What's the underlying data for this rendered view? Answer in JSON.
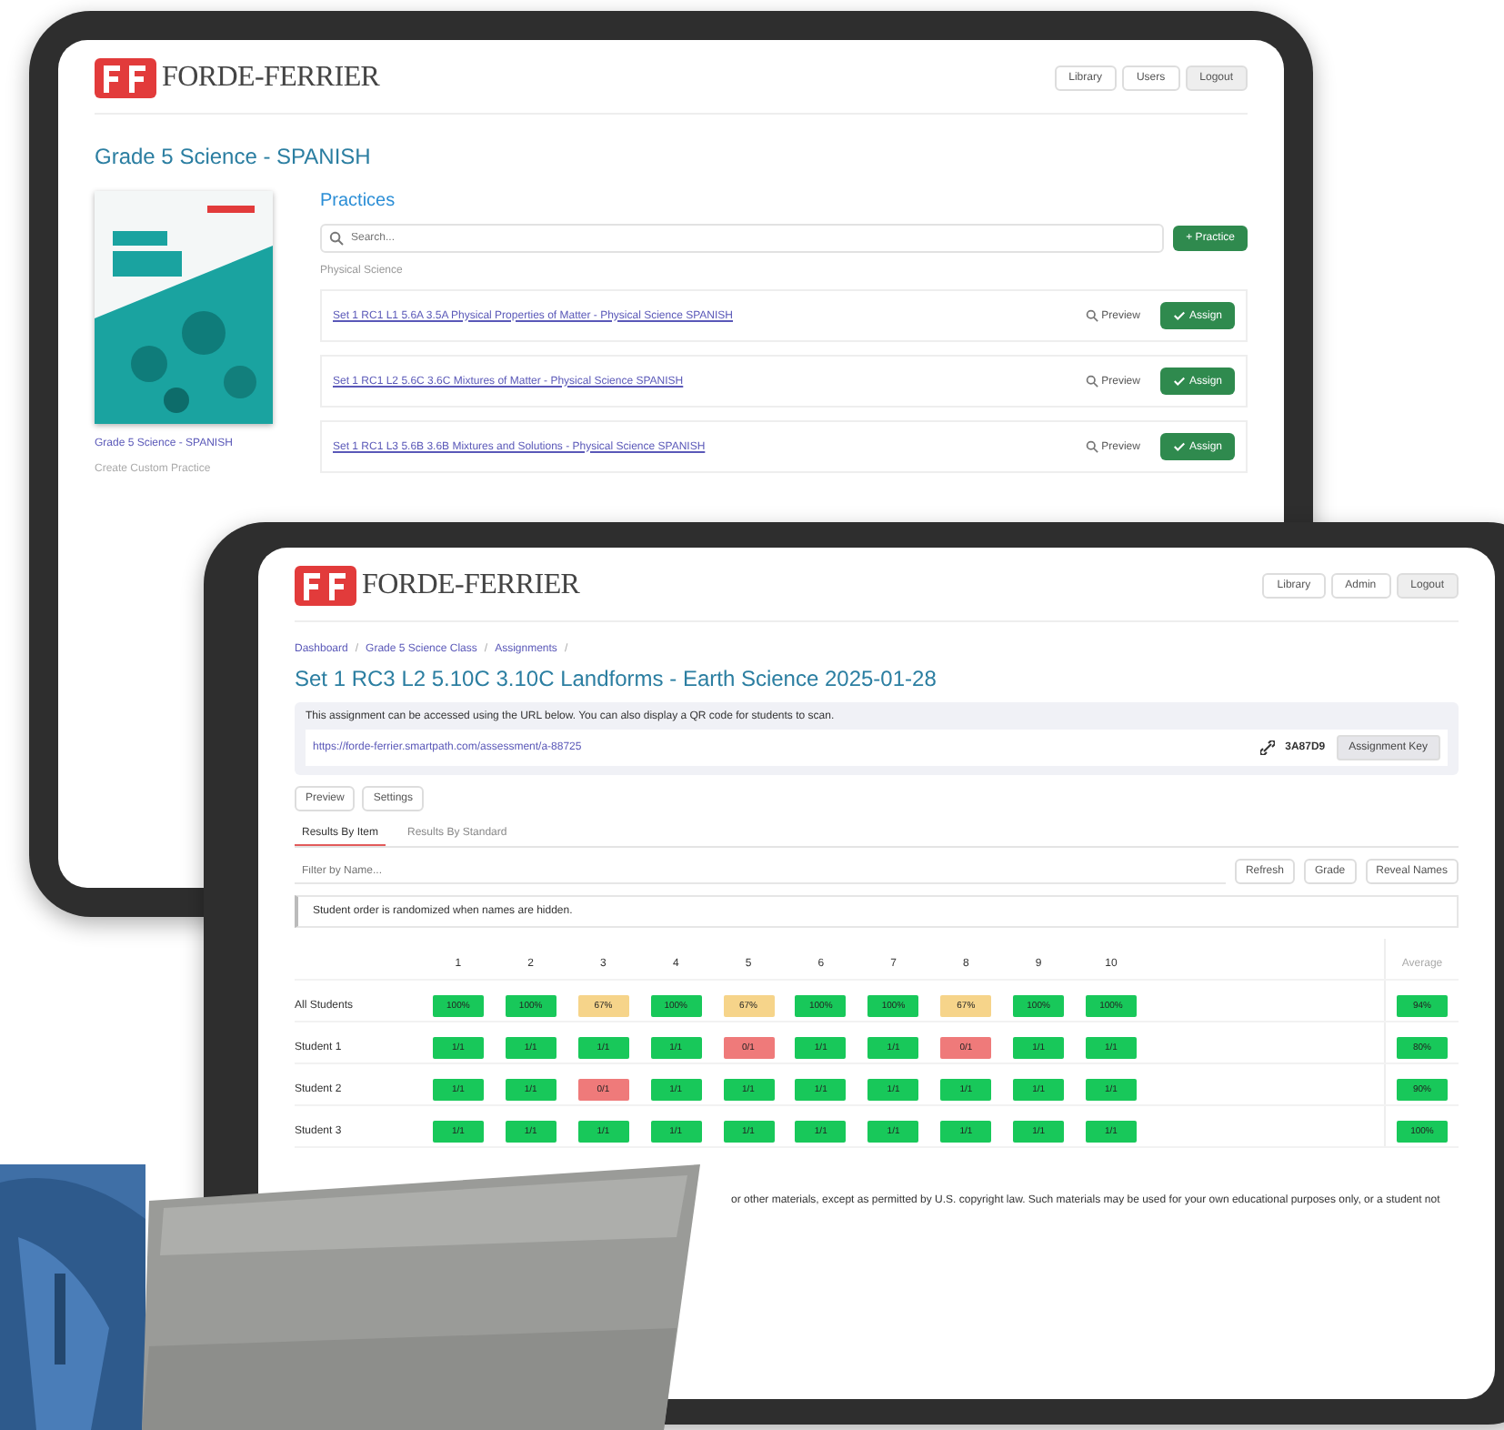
{
  "back_screen": {
    "logo": "FORDE-FERRIER",
    "header_buttons": [
      "Library",
      "Users",
      "Logout"
    ],
    "title": "Grade 5 Science - SPANISH",
    "cover_link": "Grade 5 Science - SPANISH",
    "sidebar_link": "Create Custom Practice",
    "section_title": "Practices",
    "search": {
      "placeholder": "Search..."
    },
    "add_button": "+ Practice",
    "group_label": "Physical Science",
    "practices": [
      {
        "title": "Set 1 RC1 L1 5.6A 3.5A Physical Properties of Matter - Physical Science SPANISH",
        "preview": "Preview",
        "assign": "Assign"
      },
      {
        "title": "Set 1 RC1 L2 5.6C 3.6C Mixtures of Matter - Physical Science SPANISH",
        "preview": "Preview",
        "assign": "Assign"
      },
      {
        "title": "Set 1 RC1 L3 5.6B 3.6B Mixtures and Solutions - Physical Science SPANISH",
        "preview": "Preview",
        "assign": "Assign"
      }
    ]
  },
  "front_screen": {
    "logo": "FORDE-FERRIER",
    "header_buttons": [
      "Library",
      "Admin",
      "Logout"
    ],
    "breadcrumb": [
      "Dashboard",
      "/",
      "Grade 5 Science Class",
      "/",
      "Assignments",
      "/"
    ],
    "title": "Set 1 RC3 L2 5.10C 3.10C Landforms - Earth Science 2025-01-28",
    "info": {
      "text": "This assignment can be accessed using the URL below. You can also display a QR code for students to scan.",
      "url": "https://forde-ferrier.smartpath.com/assessment/a-88725",
      "code": "3A87D9",
      "key_button": "Assignment Key"
    },
    "actions": [
      "Preview",
      "Settings"
    ],
    "tabs": [
      {
        "label": "Results By Item",
        "selected": true
      },
      {
        "label": "Results By Standard",
        "selected": false
      }
    ],
    "filter": {
      "placeholder": "Filter by Name..."
    },
    "tools": [
      "Refresh",
      "Grade",
      "Reveal Names"
    ],
    "notice": "Student order is randomized when names are hidden.",
    "grid": {
      "columns": [
        "1",
        "2",
        "3",
        "4",
        "5",
        "6",
        "7",
        "8",
        "9",
        "10"
      ],
      "average_label": "Average",
      "rows": [
        {
          "name": "All Students",
          "average": "94%",
          "cells": [
            {
              "text": "100%",
              "color": "#18c85a"
            },
            {
              "text": "100%",
              "color": "#18c85a"
            },
            {
              "text": "67%",
              "color": "#f6d48a"
            },
            {
              "text": "100%",
              "color": "#18c85a"
            },
            {
              "text": "67%",
              "color": "#f6d48a"
            },
            {
              "text": "100%",
              "color": "#18c85a"
            },
            {
              "text": "100%",
              "color": "#18c85a"
            },
            {
              "text": "67%",
              "color": "#f6d48a"
            },
            {
              "text": "100%",
              "color": "#18c85a"
            },
            {
              "text": "100%",
              "color": "#18c85a"
            }
          ]
        },
        {
          "name": "Student 1",
          "average": "80%",
          "cells": [
            {
              "text": "1/1",
              "color": "#18c85a"
            },
            {
              "text": "1/1",
              "color": "#18c85a"
            },
            {
              "text": "1/1",
              "color": "#18c85a"
            },
            {
              "text": "1/1",
              "color": "#18c85a"
            },
            {
              "text": "0/1",
              "color": "#ef7a7a"
            },
            {
              "text": "1/1",
              "color": "#18c85a"
            },
            {
              "text": "1/1",
              "color": "#18c85a"
            },
            {
              "text": "0/1",
              "color": "#ef7a7a"
            },
            {
              "text": "1/1",
              "color": "#18c85a"
            },
            {
              "text": "1/1",
              "color": "#18c85a"
            }
          ]
        },
        {
          "name": "Student 2",
          "average": "90%",
          "cells": [
            {
              "text": "1/1",
              "color": "#18c85a"
            },
            {
              "text": "1/1",
              "color": "#18c85a"
            },
            {
              "text": "0/1",
              "color": "#ef7a7a"
            },
            {
              "text": "1/1",
              "color": "#18c85a"
            },
            {
              "text": "1/1",
              "color": "#18c85a"
            },
            {
              "text": "1/1",
              "color": "#18c85a"
            },
            {
              "text": "1/1",
              "color": "#18c85a"
            },
            {
              "text": "1/1",
              "color": "#18c85a"
            },
            {
              "text": "1/1",
              "color": "#18c85a"
            },
            {
              "text": "1/1",
              "color": "#18c85a"
            }
          ]
        },
        {
          "name": "Student 3",
          "average": "100%",
          "cells": [
            {
              "text": "1/1",
              "color": "#18c85a"
            },
            {
              "text": "1/1",
              "color": "#18c85a"
            },
            {
              "text": "1/1",
              "color": "#18c85a"
            },
            {
              "text": "1/1",
              "color": "#18c85a"
            },
            {
              "text": "1/1",
              "color": "#18c85a"
            },
            {
              "text": "1/1",
              "color": "#18c85a"
            },
            {
              "text": "1/1",
              "color": "#18c85a"
            },
            {
              "text": "1/1",
              "color": "#18c85a"
            },
            {
              "text": "1/1",
              "color": "#18c85a"
            },
            {
              "text": "1/1",
              "color": "#18c85a"
            }
          ]
        }
      ]
    },
    "footer": "or other materials, except as permitted by U.S. copyright law. Such materials may be used for your own educational purposes only, or a student not"
  }
}
